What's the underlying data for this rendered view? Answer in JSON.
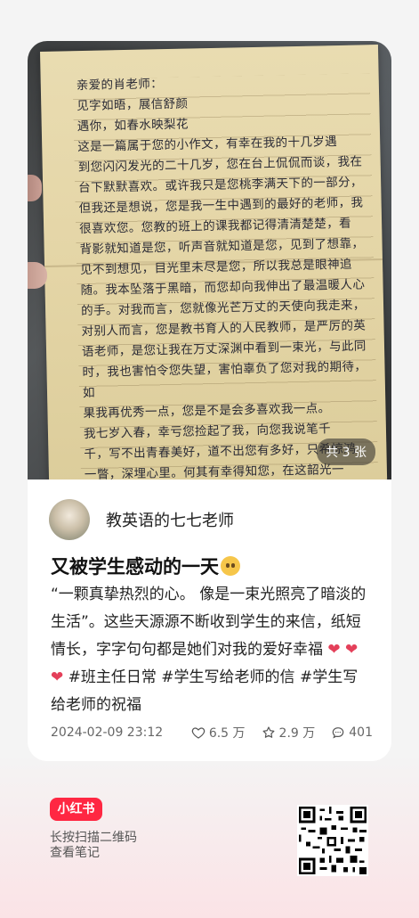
{
  "post": {
    "image_count_label": "共 3 张",
    "letter_text": "亲爱的肖老师：\n    见字如晤，展信舒颜\n    遇你，如春水映梨花\n    这是一篇属于您的小作文，有幸在我的十几岁遇\n到您闪闪发光的二十几岁，您在台上侃侃而谈，我在\n台下默默喜欢。或许我只是您桃李满天下的一部分，\n但我还是想说，您是我一生中遇到的最好的老师，我\n很喜欢您。您教的班上的课我都记得清清楚楚，看\n背影就知道是您，听声音就知道是您，见到了想靠，\n见不到想见，目光里未尽是您，所以我总是眼神追\n随。我本坠落于黑暗，而您却向我伸出了最温暖人心\n的手。对我而言，您就像光芒万丈的天使向我走来，\n对别人而言，您是教书育人的人民教师，是严厉的英\n语老师，是您让我在万丈深渊中看到一束光，与此同\n时，我也害怕令您失望，害怕辜负了您对我的期待，如\n果我再优秀一点，您是不是会多喜欢我一点。\n    我七岁入春，幸亏您捡起了我，向您我说笔千\n千，写不出青春美好，道不出您有多好，只希惊鸿\n一瞥，深埋心里。何其有幸得知您，在这韶光一\n二的青春，您是独一无二的回忆。九年级您会增上去\n嘛？您还会在这个学校教嘛？好吧，或许您也答"
  },
  "author": {
    "name": "教英语的七七老师"
  },
  "note": {
    "title": "又被学生感动的一天",
    "body_part1": "“一颗真挚热烈的心。 像是一束光照亮了暗淡的生活”。这些天源源不断收到学生的来信，纸短情长，字字句句都是她们对我的爱好幸福",
    "hearts": "❤ ❤ ❤",
    "hashtags": "#班主任日常 #学生写给老师的信 #学生写给老师的祝福",
    "date": "2024-02-09 23:12",
    "likes": "6.5 万",
    "collects": "2.9 万",
    "comments": "401"
  },
  "footer": {
    "brand": "小红书",
    "scan_hint_line1": "长按扫描二维码",
    "scan_hint_line2": "查看笔记"
  },
  "colors": {
    "brand_red": "#ff2742",
    "heart_red": "#e4405a"
  },
  "icons": [
    "heart-outline-icon",
    "star-outline-icon",
    "comment-bubble-icon",
    "qr-code-icon",
    "smiling-emoji-icon"
  ]
}
